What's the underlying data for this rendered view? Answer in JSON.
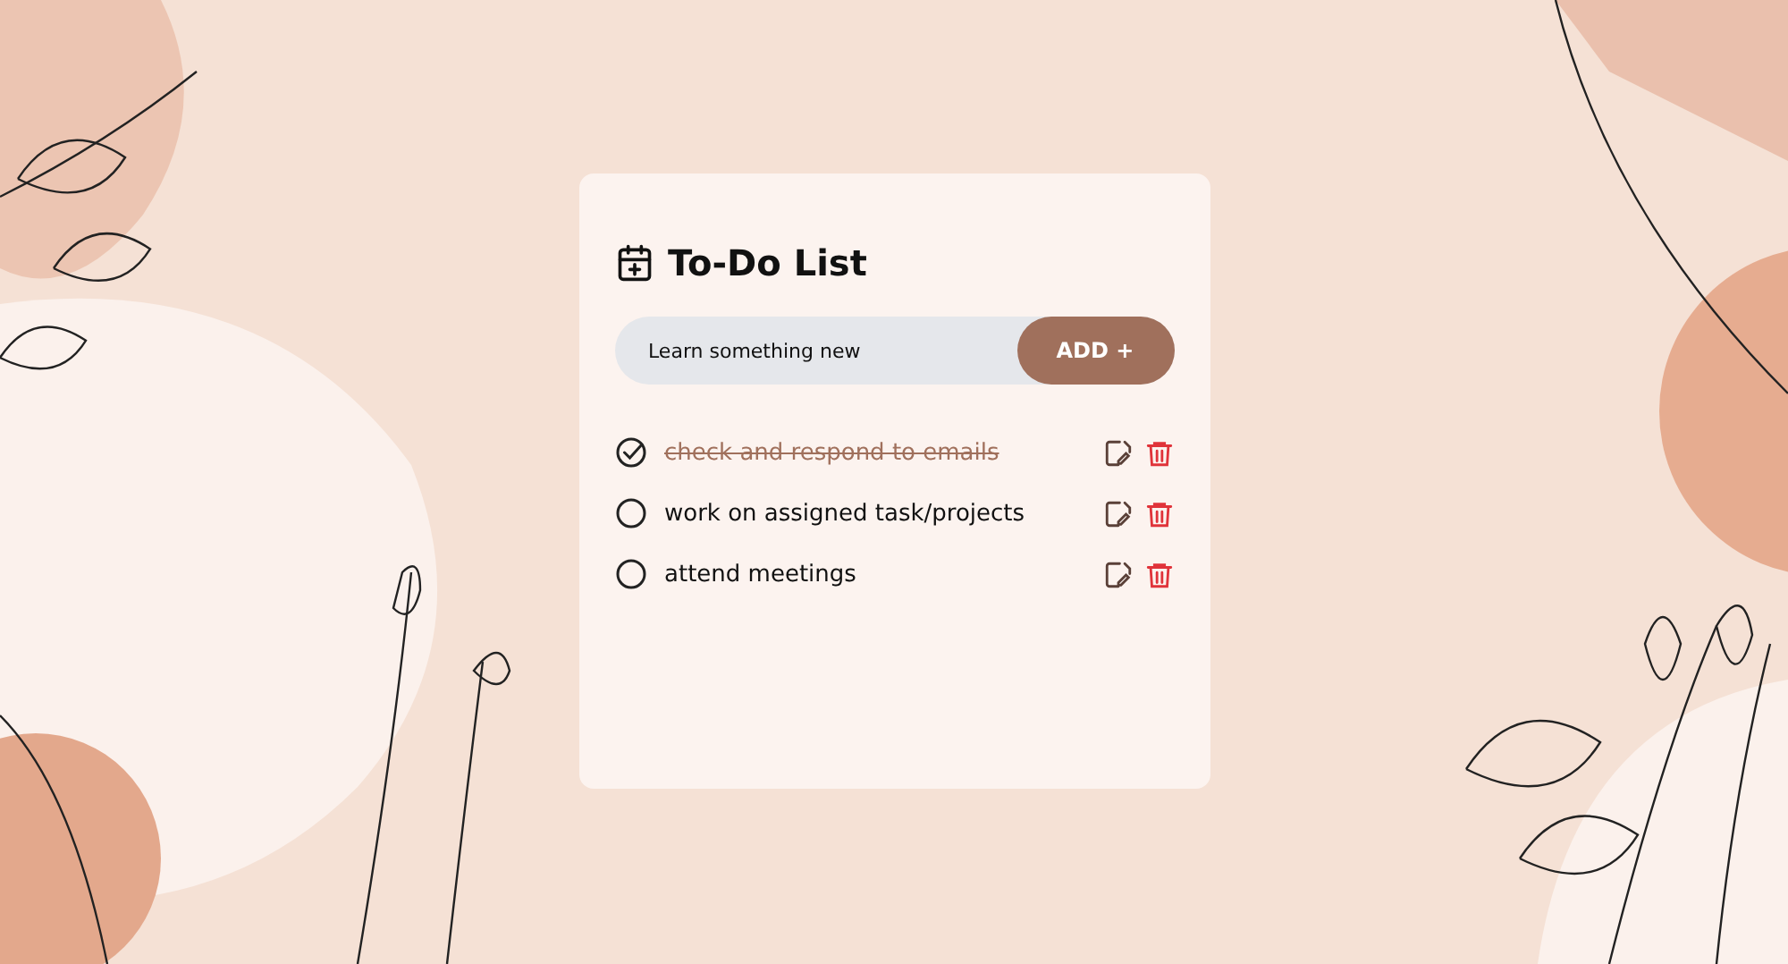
{
  "title": "To-Do List",
  "new_task": {
    "value": "Learn something new"
  },
  "add_button": "ADD +",
  "tasks": [
    {
      "text": "check and respond to emails",
      "checked": true
    },
    {
      "text": "work on assigned task/projects",
      "checked": false
    },
    {
      "text": "attend meetings",
      "checked": false
    }
  ]
}
